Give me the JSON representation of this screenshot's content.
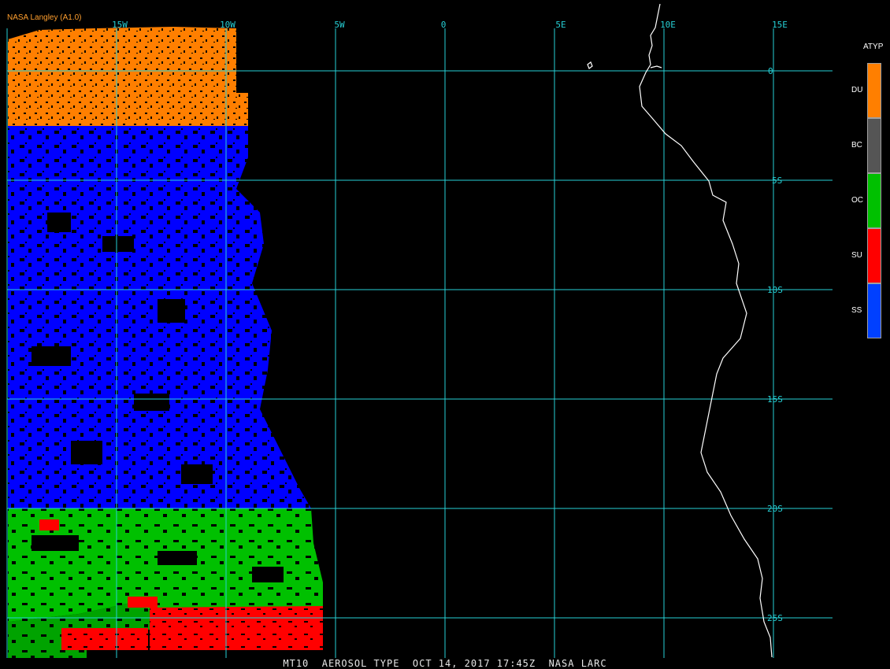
{
  "source": "NASA Langley (A1.0)",
  "footer": "MT10  AEROSOL TYPE  OCT 14, 2017 17:45Z  NASA LARC",
  "lon_labels": [
    "15W",
    "10W",
    "5W",
    "0",
    "5E",
    "10E",
    "15E"
  ],
  "lat_labels": [
    "0",
    "5S",
    "10S",
    "15S",
    "20S",
    "25S"
  ],
  "legend": {
    "title": "ATYP",
    "items": [
      {
        "code": "DU",
        "color": "#ff7f00"
      },
      {
        "code": "BC",
        "color": "#555555"
      },
      {
        "code": "OC",
        "color": "#00c000"
      },
      {
        "code": "SU",
        "color": "#ff0000"
      },
      {
        "code": "SS",
        "color": "#0040ff"
      }
    ]
  },
  "colors": {
    "grid": "#26d0d6",
    "coastline": "#ffffff",
    "du": "#ff7f00",
    "ss": "#0000ff",
    "oc": "#00c000",
    "su": "#ff0000"
  }
}
